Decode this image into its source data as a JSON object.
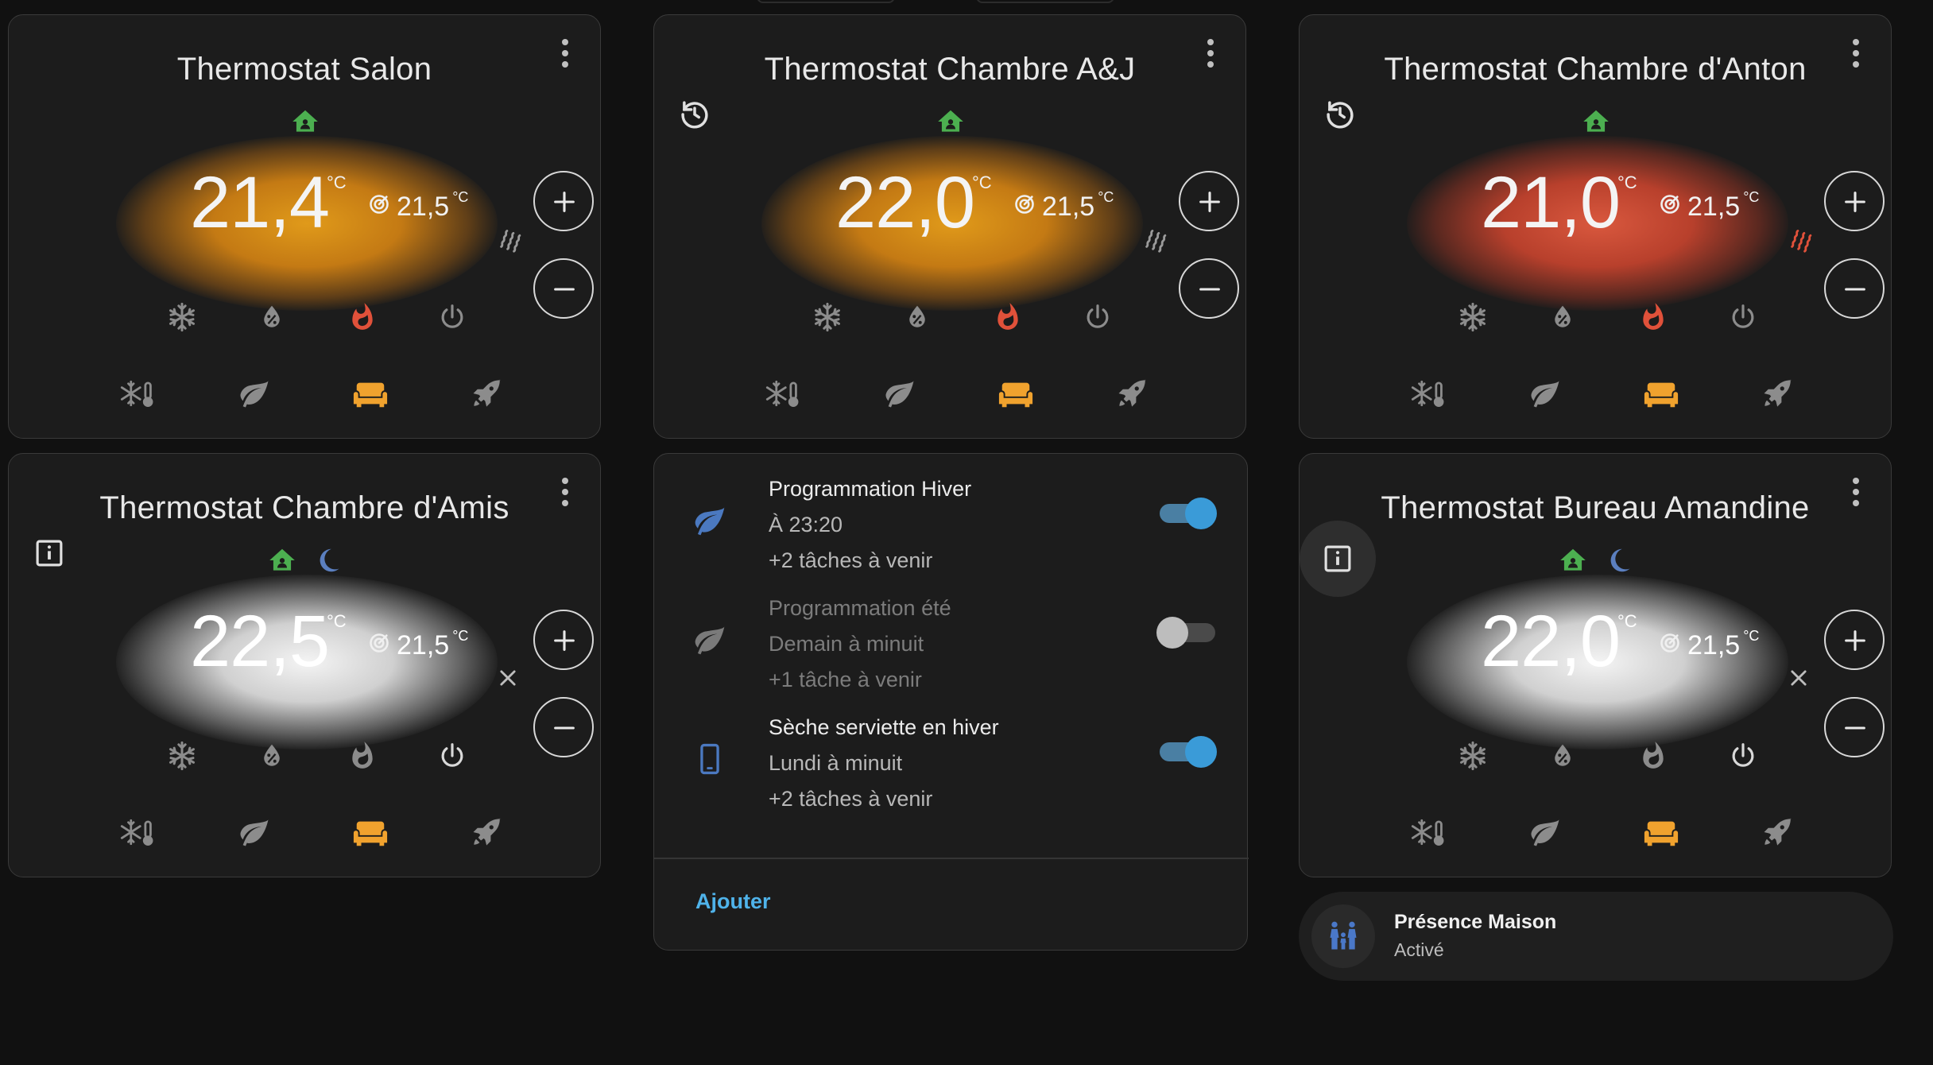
{
  "colors": {
    "background": "#111111",
    "card": "#1c1c1c",
    "green_home": "#4caf50",
    "heat_red": "#e0513a",
    "preset_orange": "#f0a22e",
    "icon_grey": "#8c8c8c",
    "moon_blue": "#5b7fbf",
    "leaf_blue": "#4b79c0",
    "accent_blue": "#3a9bd8",
    "link_blue": "#4fb3ea"
  },
  "thermostats": [
    {
      "title": "Thermostat Salon",
      "current_temp": "21,4",
      "unit": "°C",
      "target_temp": "21,5",
      "target_unit": "°C",
      "glow": "orange",
      "action_icon": "heat-waves-icon",
      "left_icon": "",
      "presets_active": [
        "home-icon"
      ],
      "hvac_mode_active": "heat",
      "preset_active": "comfort"
    },
    {
      "title": "Thermostat Chambre A&J",
      "current_temp": "22,0",
      "unit": "°C",
      "target_temp": "21,5",
      "target_unit": "°C",
      "glow": "orange",
      "action_icon": "heat-waves-icon",
      "left_icon": "history-icon",
      "presets_active": [
        "home-icon"
      ],
      "hvac_mode_active": "heat",
      "preset_active": "comfort"
    },
    {
      "title": "Thermostat Chambre d'Anton",
      "current_temp": "21,0",
      "unit": "°C",
      "target_temp": "21,5",
      "target_unit": "°C",
      "glow": "red",
      "action_icon": "heat-waves-active-icon",
      "left_icon": "history-icon",
      "presets_active": [
        "home-icon"
      ],
      "hvac_mode_active": "heat",
      "preset_active": "comfort"
    },
    {
      "title": "Thermostat Chambre d'Amis",
      "current_temp": "22,5",
      "unit": "°C",
      "target_temp": "21,5",
      "target_unit": "°C",
      "glow": "white",
      "action_icon": "close-icon",
      "left_icon": "info-icon",
      "presets_active": [
        "home-icon",
        "moon-icon"
      ],
      "hvac_mode_active": "off",
      "preset_active": "comfort"
    },
    {
      "title": "Thermostat Bureau Amandine",
      "current_temp": "22,0",
      "unit": "°C",
      "target_temp": "21,5",
      "target_unit": "°C",
      "glow": "white",
      "action_icon": "close-icon",
      "left_icon": "info-icon-circled",
      "presets_active": [
        "home-icon",
        "moon-icon"
      ],
      "hvac_mode_active": "off",
      "preset_active": "comfort"
    }
  ],
  "schedules": {
    "items": [
      {
        "icon": "leaf-icon",
        "title": "Programmation Hiver",
        "when": "À 23:20",
        "more": "+2 tâches à venir",
        "enabled": true
      },
      {
        "icon": "leaf-icon",
        "title": "Programmation été",
        "when": "Demain à minuit",
        "more": "+1 tâche à venir",
        "enabled": false
      },
      {
        "icon": "phone-icon",
        "title": "Sèche serviette en hiver",
        "when": "Lundi à minuit",
        "more": "+2 tâches à venir",
        "enabled": true
      }
    ],
    "add_label": "Ajouter"
  },
  "presence": {
    "title": "Présence Maison",
    "state": "Activé"
  }
}
